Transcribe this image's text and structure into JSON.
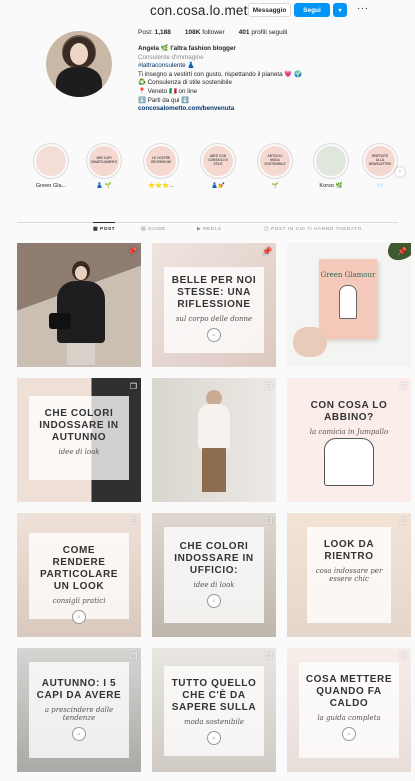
{
  "header": {
    "username": "con.cosa.lo.metto",
    "message_label": "Messaggio",
    "follow_label": "Segui",
    "suggest_icon": "▾",
    "more_icon": "···"
  },
  "stats": {
    "posts": "1,188",
    "posts_label": "Post:",
    "followers": "108K",
    "followers_label": "follower",
    "following": "401",
    "following_label": "profili seguiti"
  },
  "bio": {
    "name": "Angela 🌿 l'altra fashion blogger",
    "category": "Consulente d'immagine",
    "line1": "#laltraconsulente 👗",
    "line2": "Ti insegno a vestirti con gusto, rispettando il pianeta 💗 🌍",
    "line3": "♻️ Consulenza di stile sostenibile",
    "line4": "📍 Veneto 🇮🇹 on line",
    "line5": "⬇️ Parti da qui ⬇️",
    "link": "concosalometto.com/benvenuta"
  },
  "highlights": [
    {
      "inner": "",
      "label": "Green Gla..."
    },
    {
      "inner": "MIEI CAPI SMARTUAMENTI",
      "label": "👗 🌱"
    },
    {
      "inner": "LE VOSTRE RECENSIONI",
      "label": "⭐⭐⭐..."
    },
    {
      "inner": "ABITI CON CONSIGLI DI STILE",
      "label": "👗💅"
    },
    {
      "inner": "ARTICOLI MODA SOSTENIBILE",
      "label": "🌱"
    },
    {
      "inner": "",
      "label": "Korso 🌿"
    },
    {
      "inner": "RISPOSTE ALLA NEWSLETTER",
      "label": "📨"
    }
  ],
  "tabs": {
    "posts": "POST",
    "guides": "GUIDE",
    "reels": "REELS",
    "tagged": "POST IN CUI TI HANNO TAGGATO"
  },
  "posts": [
    {
      "title": "",
      "sub": ""
    },
    {
      "title": "BELLE PER NOI STESSE: UNA RIFLESSIONE",
      "sub": "sul corpo delle donne"
    },
    {
      "title": "Green Glamour",
      "sub": ""
    },
    {
      "title": "CHE COLORI INDOSSARE IN AUTUNNO",
      "sub": "idee di look"
    },
    {
      "title": "",
      "sub": ""
    },
    {
      "title": "CON COSA LO ABBINO?",
      "sub": "la camicia in Jumpallo"
    },
    {
      "title": "COME RENDERE PARTICOLARE UN LOOK",
      "sub": "consigli pratici"
    },
    {
      "title": "CHE COLORI INDOSSARE IN UFFICIO:",
      "sub": "idee di look"
    },
    {
      "title": "LOOK DA RIENTRO",
      "sub": "cosa indossare per essere chic"
    },
    {
      "title": "AUTUNNO: I 5 CAPI DA AVERE",
      "sub": "a prescindere dalle tendenze"
    },
    {
      "title": "TUTTO QUELLO CHE C'È DA SAPERE SULLA",
      "sub": "moda sostenibile"
    },
    {
      "title": "COSA METTERE QUANDO FA CALDO",
      "sub": "la guida completa"
    }
  ]
}
